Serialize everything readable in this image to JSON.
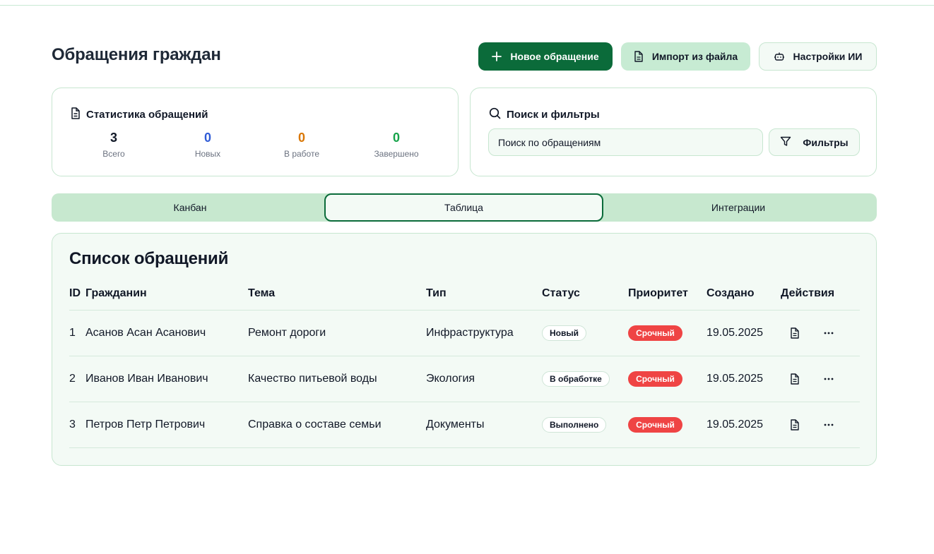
{
  "page": {
    "title": "Обращения граждан"
  },
  "header_buttons": {
    "new_label": "Новое обращение",
    "import_label": "Импорт из файла",
    "ai_label": "Настройки ИИ"
  },
  "stats": {
    "title": "Статистика обращений",
    "items": [
      {
        "value": "3",
        "label": "Всего",
        "color": "#111827"
      },
      {
        "value": "0",
        "label": "Новых",
        "color": "#2f5bd6"
      },
      {
        "value": "0",
        "label": "В работе",
        "color": "#d97706"
      },
      {
        "value": "0",
        "label": "Завершено",
        "color": "#16a34a"
      }
    ]
  },
  "search": {
    "title": "Поиск и фильтры",
    "input_value": "Поиск по обращениям",
    "filter_label": "Фильтры"
  },
  "tabs": [
    {
      "label": "Канбан",
      "active": false
    },
    {
      "label": "Таблица",
      "active": true
    },
    {
      "label": "Интеграции",
      "active": false
    }
  ],
  "table": {
    "title": "Список обращений",
    "columns": [
      "ID",
      "Гражданин",
      "Тема",
      "Тип",
      "Статус",
      "Приоритет",
      "Создано",
      "Действия"
    ],
    "rows": [
      {
        "id": "1",
        "citizen": "Асанов Асан Асанович",
        "topic": "Ремонт дороги",
        "type": "Инфраструктура",
        "status": "Новый",
        "priority": "Срочный",
        "created": "19.05.2025"
      },
      {
        "id": "2",
        "citizen": "Иванов Иван Иванович",
        "topic": "Качество питьевой воды",
        "type": "Экология",
        "status": "В обработке",
        "priority": "Срочный",
        "created": "19.05.2025"
      },
      {
        "id": "3",
        "citizen": "Петров Петр Петрович",
        "topic": "Справка о составе семьи",
        "type": "Документы",
        "status": "Выполнено",
        "priority": "Срочный",
        "created": "19.05.2025"
      }
    ]
  },
  "icons": {
    "new": "plus-icon",
    "import": "file-icon",
    "ai": "bot-icon",
    "stats": "file-text-icon",
    "search": "search-icon",
    "filter": "filter-icon",
    "row_doc": "file-text-icon",
    "row_more": "more-horizontal-icon"
  },
  "colors": {
    "primary": "#0b6b3a",
    "accent_light": "#c7ebd3",
    "panel_bg": "#f3faf5",
    "danger": "#ef4444"
  }
}
